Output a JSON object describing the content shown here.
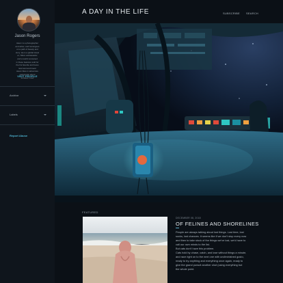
{
  "sidebar": {
    "author_name": "Jason Rogers",
    "bio_lines": [
      "Jason is a photographer",
      "and writer, and focus/goes",
      "on a path of beauty and",
      "story. He is a global travel",
      "er, Nikon ambassador",
      "and a world renowned",
      "in these features sold for",
      "the his favorite and loves",
      "land and and travel",
      "Jason likes in adventure",
      "passionate about",
      "sunsets 1 and"
    ],
    "visit_label": "VISIT PROFILE",
    "archive_label": "Archive",
    "labels_label": "Labels",
    "report_label": "Report Abuse"
  },
  "header": {
    "site_title": "A DAY IN THE LIFE",
    "subscribe_label": "SUBSCRIBE",
    "search_label": "SEARCH"
  },
  "post": {
    "featured_label": "FEATURED",
    "date": "DECEMBER 08, 2018",
    "title": "OF FELINES AND SHORELINES",
    "excerpt_lines": [
      "People are always talking about lost things. Lost time, lost",
      "socks, lost chances. It seems like if we don't stop every now",
      "and then to take stock of the things we've lost, we'd have to",
      "call our own minds to the list.",
      "But cats don't have this problem.",
      "Cats hold by chase, catch, and lose without things a minute,",
      "and race right on to the next one with undiminished gusto,",
      "ready to try anything and everything once again, ready to",
      "give the grand pursuit another shot (using everything but",
      "the whole point."
    ]
  },
  "colors": {
    "background": "#0b1016",
    "sidebar": "#0f151c",
    "accent": "#4fb8d6"
  }
}
